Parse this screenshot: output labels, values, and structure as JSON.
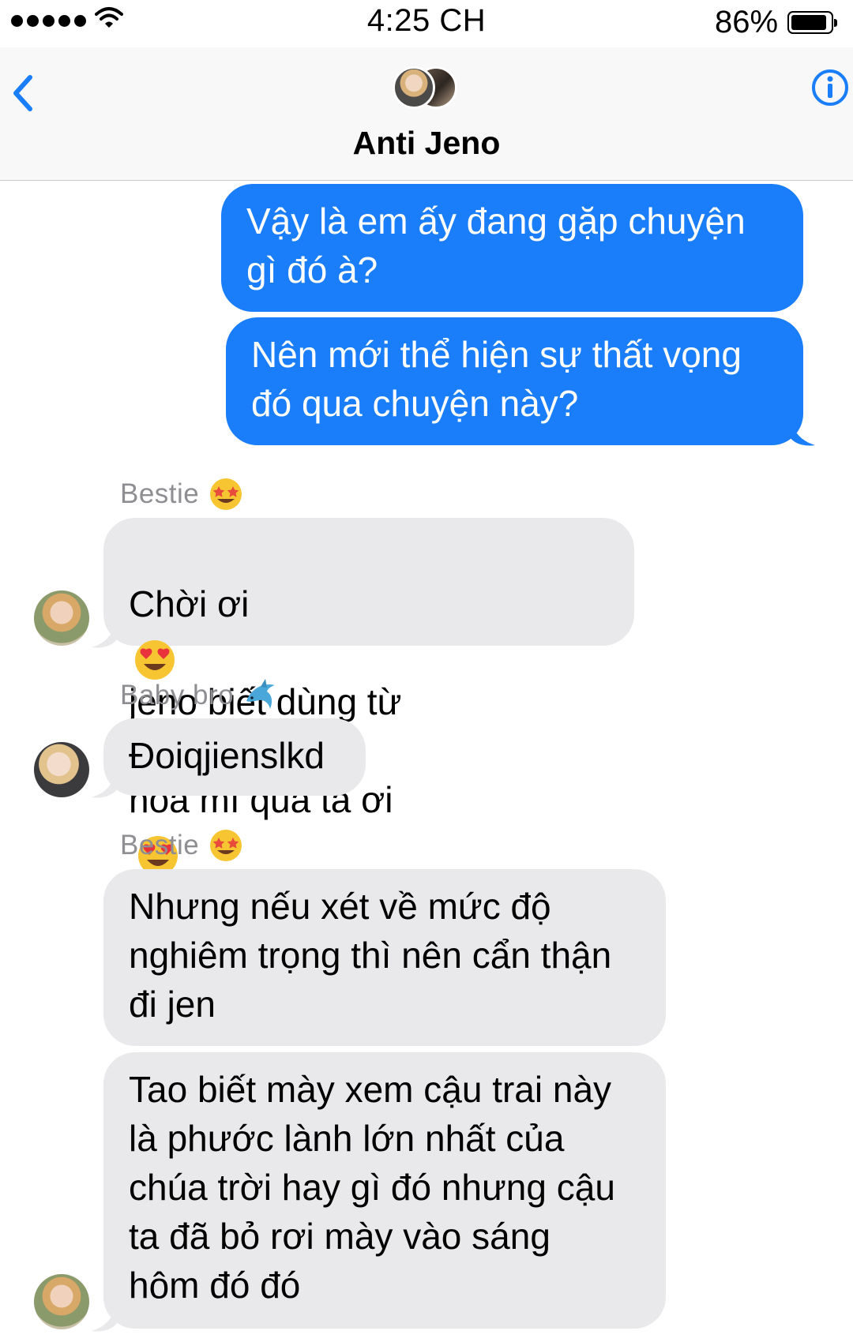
{
  "status_bar": {
    "time": "4:25 CH",
    "battery_percent": "86%",
    "battery_level": 0.86,
    "signal_icon": "signal-dots-icon",
    "wifi_icon": "wifi-icon"
  },
  "header": {
    "title": "Anti Jeno",
    "back_icon": "chevron-left-icon",
    "info_icon": "info-icon",
    "accent_color": "#1a7df9"
  },
  "messages": {
    "outgoing": [
      "Vậy là em ấy đang gặp chuyện\ngì đó à?",
      "Nên mới thể hiện sự thất vọng\nđó qua chuyện này?"
    ],
    "group1": {
      "sender": "Bestie",
      "sender_emoji": "star-struck-emoji",
      "line1_a": "Chời ơi",
      "line1_b": "jeno biết dùng từ",
      "line2_a": "hoa mĩ quá ta ơi",
      "inline_emoji": "heart-eyes-emoji"
    },
    "group2": {
      "sender": "Baby bro",
      "sender_emoji": "dolphin-emoji",
      "text": "Đoiqjienslkd"
    },
    "group3": {
      "sender": "Bestie",
      "sender_emoji": "star-struck-emoji",
      "texts": [
        "Nhưng nếu xét về mức độ\nnghiêm trọng thì nên cẩn thận\nđi jen",
        "Tao biết mày xem cậu trai này\nlà phước lành lớn nhất của\nchúa trời hay gì đó nhưng cậu\nta đã bỏ rơi mày vào sáng\nhôm đó đó"
      ]
    }
  }
}
